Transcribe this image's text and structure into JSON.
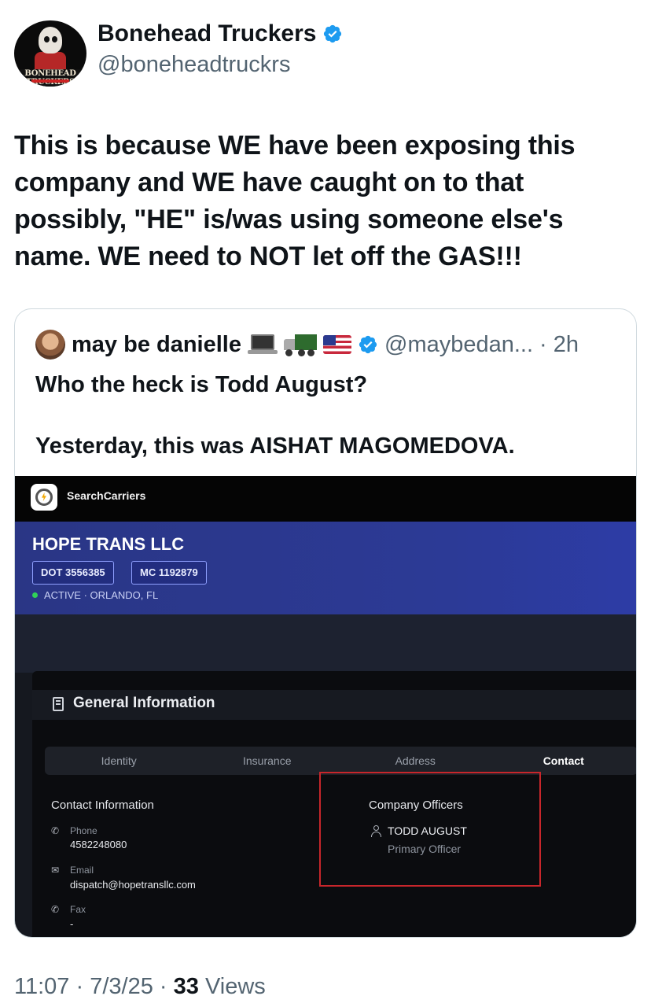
{
  "author": {
    "name": "Bonehead Truckers",
    "handle": "@boneheadtruckrs",
    "avatar_text": "BONEHEAD TRUCKERS",
    "verified_icon": "verified-badge-icon"
  },
  "tweet": {
    "text": "This is because WE have been exposing this company and WE have caught on to that possibly, \"HE\" is/was using someone else's name. WE need to NOT let off the GAS!!!"
  },
  "quote": {
    "name": "may be danielle",
    "emojis": [
      "laptop-icon",
      "truck-icon",
      "us-flag-icon"
    ],
    "handle": "@maybedan...",
    "time": "· 2h",
    "line1": "Who the heck is Todd August?",
    "line2": "Yesterday, this was AISHAT MAGOMEDOVA."
  },
  "screenshot": {
    "app_name": "SearchCarriers",
    "company": "HOPE TRANS LLC",
    "dot": "DOT 3556385",
    "mc": "MC 1192879",
    "status": "ACTIVE · ORLANDO, FL",
    "section_title": "General Information",
    "tabs": [
      "Identity",
      "Insurance",
      "Address",
      "Contact"
    ],
    "active_tab": "Contact",
    "contact_title": "Contact Information",
    "phone_label": "Phone",
    "phone_value": "4582248080",
    "email_label": "Email",
    "email_value": "dispatch@hopetransllc.com",
    "fax_label": "Fax",
    "fax_value": "-",
    "officers_title": "Company Officers",
    "officer_name": "TODD AUGUST",
    "officer_role": "Primary Officer",
    "highlight_color": "#c8262b"
  },
  "footer": {
    "time": "11:07",
    "sep1": " · ",
    "date": "7/3/25",
    "sep2": " · ",
    "views_count": "33",
    "views_label": " Views"
  },
  "colors": {
    "verified_blue": "#1d9bf0",
    "secondary_text": "#536471",
    "hero_blue": "#2c3a96"
  }
}
